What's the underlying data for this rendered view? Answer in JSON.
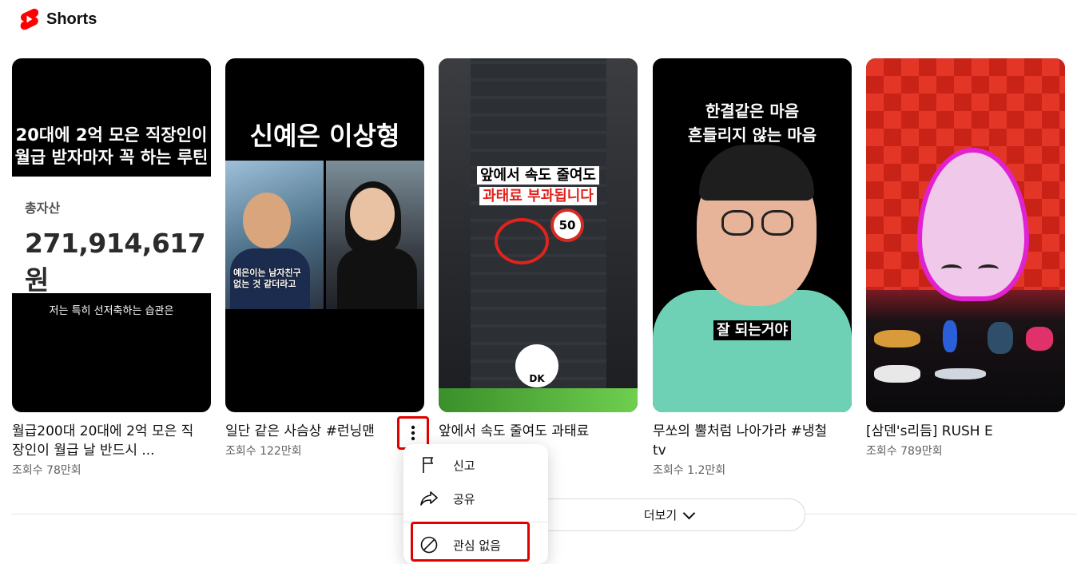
{
  "header": {
    "title": "Shorts",
    "logo_icon": "youtube-shorts-logo",
    "accent": "#ff0000"
  },
  "cards": [
    {
      "title": "월급200대 20대에 2억 모은 직장인이 월급 날 반드시 ...",
      "views": "조회수 78만회",
      "thumb": {
        "top_line1": "20대에 2억 모은 직장인이",
        "top_line2": "월급 받자마자 꼭 하는 루틴",
        "panel_label": "총자산",
        "panel_value": "271,914,617원",
        "bottom": "저는 특히 선저축하는 습관은"
      }
    },
    {
      "title": "일단 같은 사슴상 #런닝맨",
      "views": "조회수 122만회",
      "thumb": {
        "top": "신예은 이상형",
        "caption1": "예은이는 남자친구",
        "caption2": "없는 것 같더라고"
      }
    },
    {
      "title": "앞에서 속도 줄여도 과태료",
      "views": "",
      "thumb": {
        "line1": "앞에서 속도 줄여도",
        "line2": "과태료 부과됩니다",
        "sign": "50",
        "badge": "DK"
      }
    },
    {
      "title": "무쏘의 뿔처럼 나아가라 #냉철tv",
      "views": "조회수 1.2만회",
      "thumb": {
        "line1": "한결같은 마음",
        "line2": "흔들리지 않는 마음",
        "caption": "잘 되는거야"
      }
    },
    {
      "title": "[삼덴's리듬] RUSH E",
      "views": "조회수 789만회",
      "thumb": {}
    }
  ],
  "show_more": {
    "label": "더보기"
  },
  "menu": {
    "items": [
      {
        "label": "신고",
        "icon": "flag-icon"
      },
      {
        "label": "공유",
        "icon": "share-icon"
      },
      {
        "label": "관심 없음",
        "icon": "not-interested-icon"
      }
    ]
  }
}
